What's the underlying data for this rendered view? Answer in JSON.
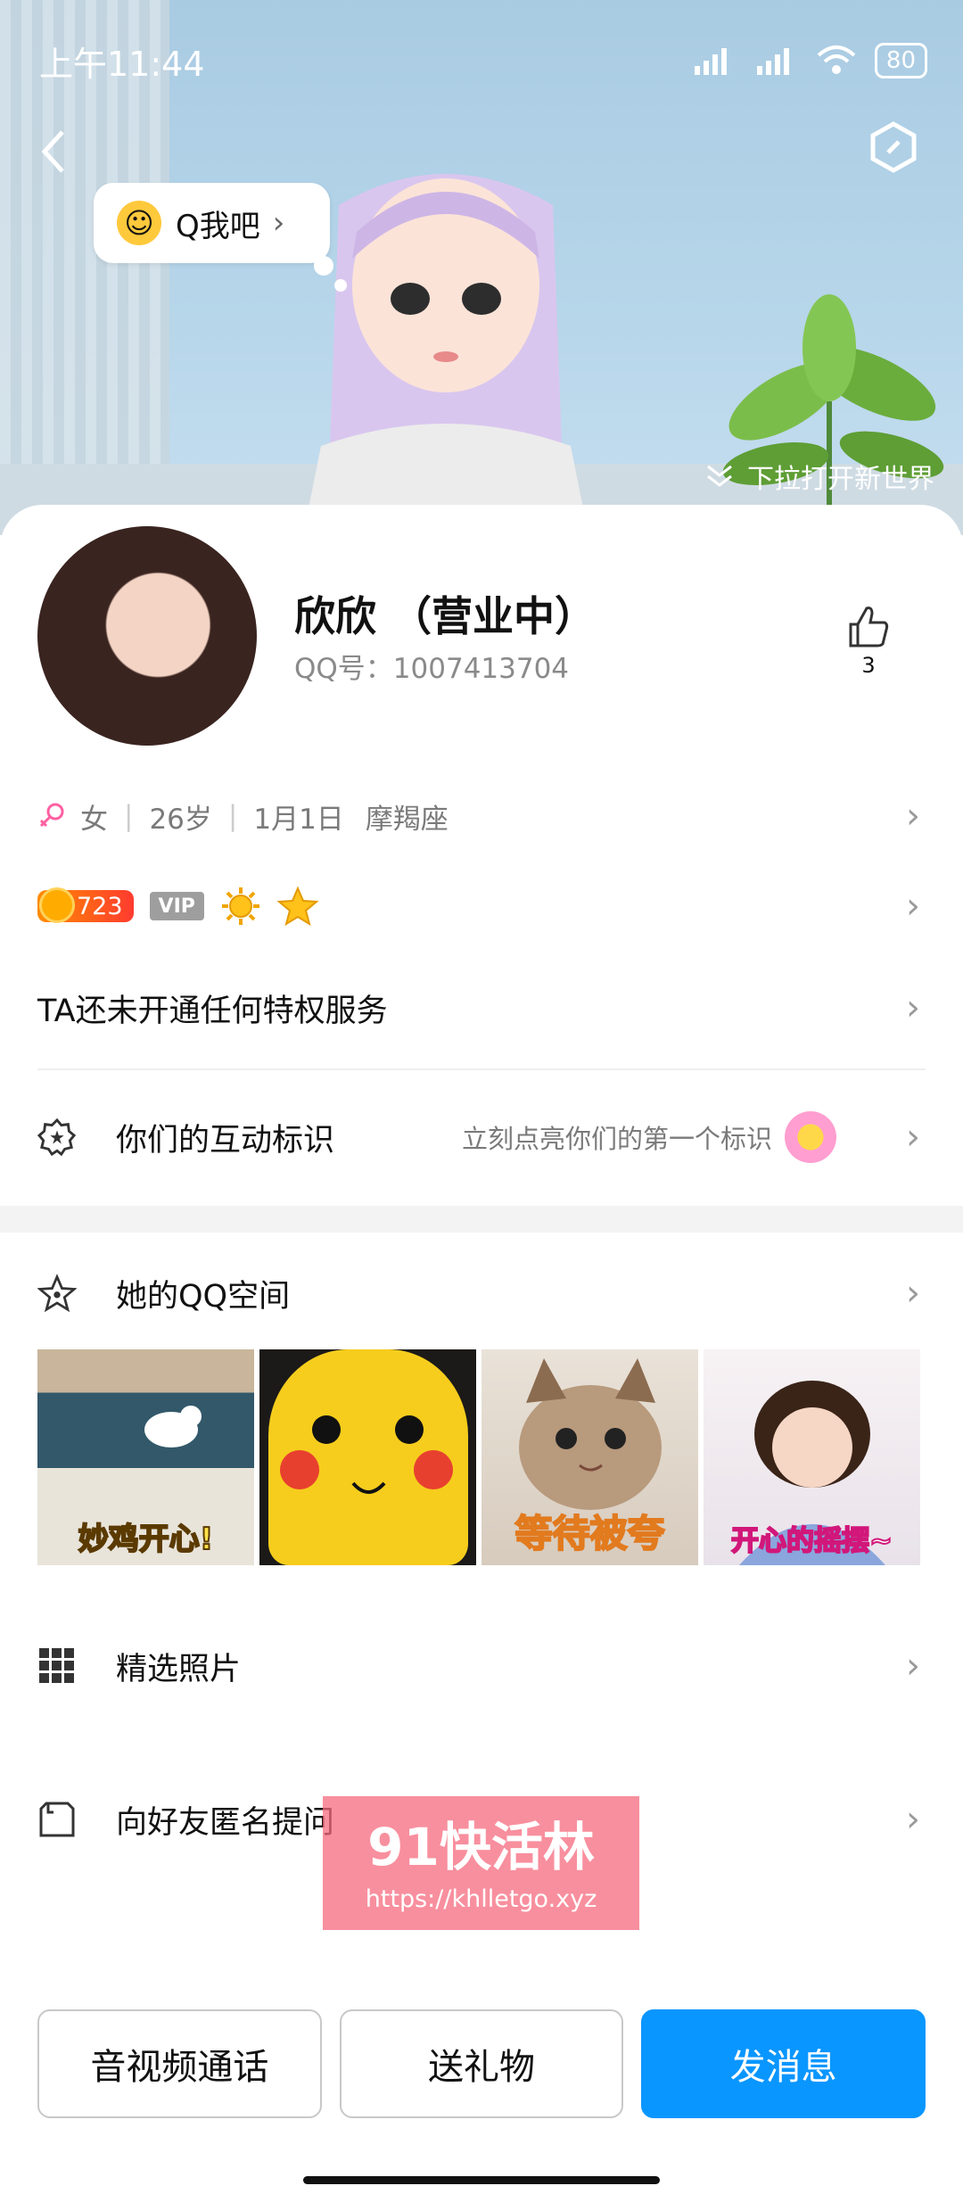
{
  "status_bar": {
    "time": "上午11:44",
    "battery": "80"
  },
  "hero": {
    "bubble_text": "Q我吧",
    "pull_text": "下拉打开新世界"
  },
  "profile": {
    "name": "欣欣 （营业中）",
    "qq_label": "QQ号：1007413704",
    "likes": "3"
  },
  "info": {
    "gender": "女",
    "age": "26岁",
    "birthday": "1月1日",
    "zodiac": "摩羯座"
  },
  "badges": {
    "level": "723",
    "vip": "VIP"
  },
  "privilege": {
    "text": "TA还未开通任何特权服务"
  },
  "interaction": {
    "label": "你们的互动标识",
    "hint": "立刻点亮你们的第一个标识"
  },
  "qzone": {
    "label": "她的QQ空间",
    "photos": [
      "妙鸡开心!",
      "",
      "等待被夸",
      "开心的摇摆~"
    ]
  },
  "menu": {
    "selected_photos": "精选照片",
    "anonymous_question": "向好友匿名提问"
  },
  "watermark": {
    "title": "91快活林",
    "url": "https://khlletgo.xyz"
  },
  "actions": {
    "call": "音视频通话",
    "gift": "送礼物",
    "message": "发消息"
  },
  "colors": {
    "primary": "#0a96ff",
    "gender_icon": "#ff5fa2"
  }
}
